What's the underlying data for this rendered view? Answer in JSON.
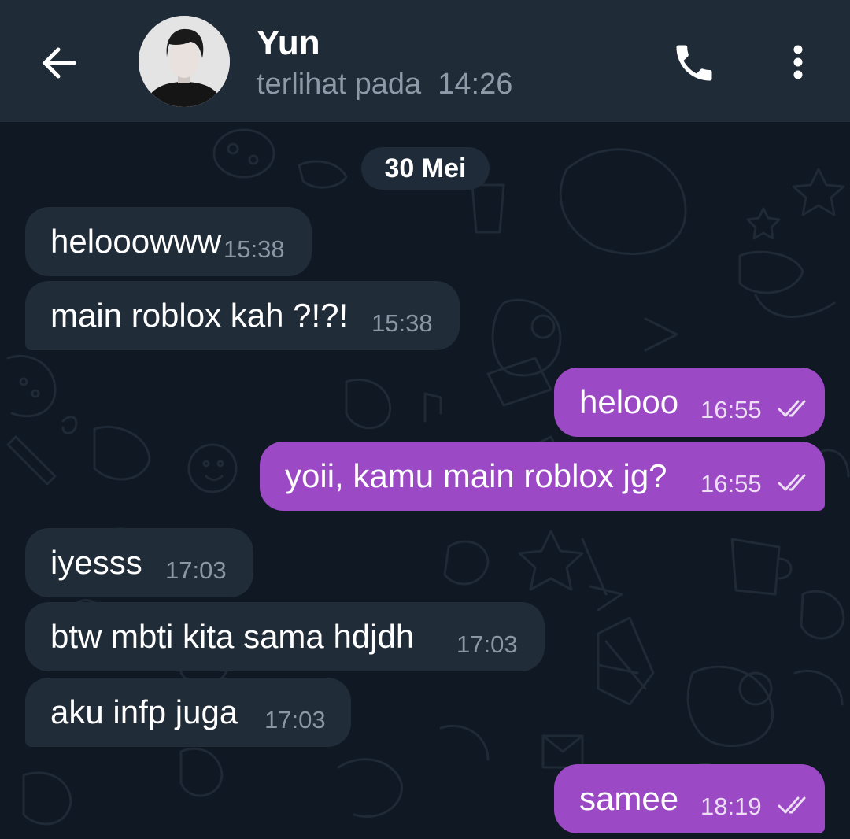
{
  "header": {
    "contact_name": "Yun",
    "last_seen_label": "terlihat pada",
    "last_seen_time": "14:26"
  },
  "icons": {
    "back": "arrow-left-icon",
    "call": "phone-icon",
    "menu": "more-vertical-icon",
    "read_receipt": "double-check-icon"
  },
  "colors": {
    "header_bg": "#202b38",
    "chat_bg": "#0f1823",
    "incoming_bubble": "#212c39",
    "outgoing_bubble": "#9b49c4"
  },
  "chat": {
    "date_separator": "30 Mei",
    "messages": [
      {
        "direction": "in",
        "text": "helooowww",
        "time": "15:38"
      },
      {
        "direction": "in",
        "text": "main roblox kah ?!?!",
        "time": "15:38"
      },
      {
        "direction": "out",
        "text": "helooo",
        "time": "16:55",
        "read": true
      },
      {
        "direction": "out",
        "text": "yoii, kamu main roblox jg?",
        "time": "16:55",
        "read": true
      },
      {
        "direction": "in",
        "text": "iyesss",
        "time": "17:03"
      },
      {
        "direction": "in",
        "text": "btw mbti kita sama hdjdh",
        "time": "17:03"
      },
      {
        "direction": "in",
        "text": "aku infp juga",
        "time": "17:03"
      },
      {
        "direction": "out",
        "text": "samee",
        "time": "18:19",
        "read": true
      }
    ]
  }
}
